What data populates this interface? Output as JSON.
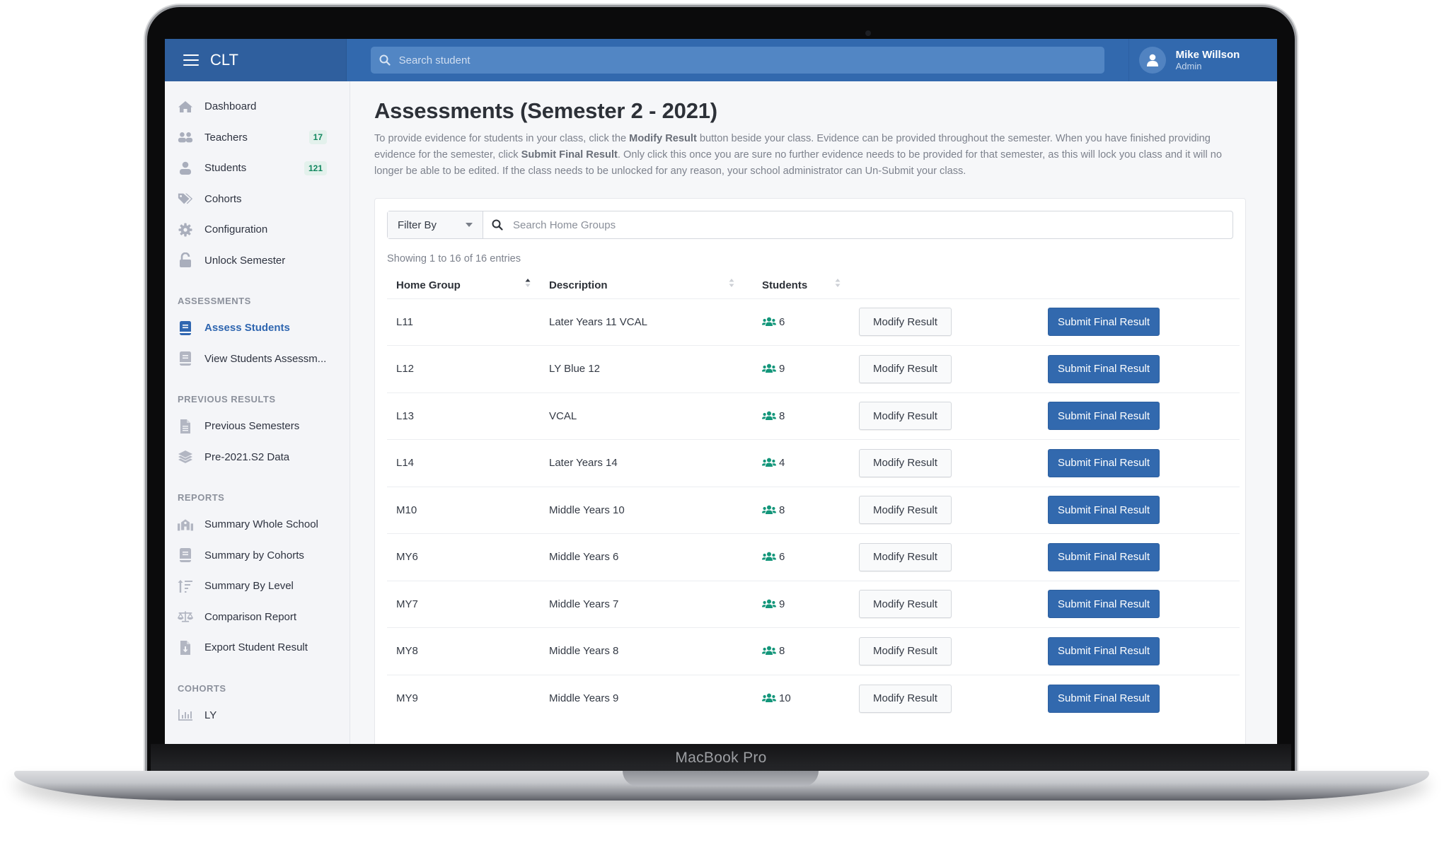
{
  "device": {
    "label": "MacBook Pro"
  },
  "topbar": {
    "app_name": "CLT",
    "search_placeholder": "Search student",
    "user": {
      "name": "Mike Willson",
      "role": "Admin"
    }
  },
  "sidebar": {
    "main_items": [
      {
        "label": "Dashboard",
        "icon": "home-icon"
      },
      {
        "label": "Teachers",
        "icon": "users-icon",
        "badge": "17"
      },
      {
        "label": "Students",
        "icon": "user-icon",
        "badge": "121"
      },
      {
        "label": "Cohorts",
        "icon": "tags-icon"
      },
      {
        "label": "Configuration",
        "icon": "gear-icon"
      },
      {
        "label": "Unlock Semester",
        "icon": "unlock-icon"
      }
    ],
    "sections": [
      {
        "title": "ASSESSMENTS",
        "items": [
          {
            "label": "Assess Students",
            "icon": "book-icon",
            "active": true
          },
          {
            "label": "View Students Assessm...",
            "icon": "book-icon"
          }
        ]
      },
      {
        "title": "PREVIOUS RESULTS",
        "items": [
          {
            "label": "Previous Semesters",
            "icon": "file-icon"
          },
          {
            "label": "Pre-2021.S2 Data",
            "icon": "layers-icon"
          }
        ]
      },
      {
        "title": "REPORTS",
        "items": [
          {
            "label": "Summary Whole School",
            "icon": "school-icon"
          },
          {
            "label": "Summary by Cohorts",
            "icon": "book-icon"
          },
          {
            "label": "Summary By Level",
            "icon": "sort-amount-icon"
          },
          {
            "label": "Comparison Report",
            "icon": "balance-scale-icon"
          },
          {
            "label": "Export Student Result",
            "icon": "file-download-icon"
          }
        ]
      },
      {
        "title": "COHORTS",
        "items": [
          {
            "label": "LY",
            "icon": "bar-chart-icon"
          }
        ]
      }
    ]
  },
  "main": {
    "title": "Assessments (Semester 2 - 2021)",
    "description": {
      "p1": "To provide evidence for students in your class, click the ",
      "b1": "Modify Result",
      "p2": " button beside your class. Evidence can be provided throughout the semester. When you have finished providing evidence for the semester, click ",
      "b2": "Submit Final Result",
      "p3": ". Only click this once you are sure no further evidence needs to be provided for that semester, as this will lock you class and it will no longer be able to be edited. If the class needs to be unlocked for any reason, your school administrator can Un-Submit your class."
    },
    "filter": {
      "label": "Filter By",
      "search_placeholder": "Search Home Groups"
    },
    "showing": "Showing 1 to 16 of 16 entries",
    "table": {
      "headers": {
        "home_group": "Home Group",
        "description": "Description",
        "students": "Students"
      },
      "modify_label": "Modify Result",
      "submit_label": "Submit Final Result",
      "rows": [
        {
          "home_group": "L11",
          "description": "Later Years 11 VCAL",
          "students": "6"
        },
        {
          "home_group": "L12",
          "description": "LY Blue 12",
          "students": "9"
        },
        {
          "home_group": "L13",
          "description": "VCAL",
          "students": "8"
        },
        {
          "home_group": "L14",
          "description": "Later Years 14",
          "students": "4"
        },
        {
          "home_group": "M10",
          "description": "Middle Years 10",
          "students": "8"
        },
        {
          "home_group": "MY6",
          "description": "Middle Years 6",
          "students": "6"
        },
        {
          "home_group": "MY7",
          "description": "Middle Years 7",
          "students": "9"
        },
        {
          "home_group": "MY8",
          "description": "Middle Years 8",
          "students": "8"
        },
        {
          "home_group": "MY9",
          "description": "Middle Years 9",
          "students": "10"
        }
      ]
    }
  },
  "colors": {
    "primary": "#3269ae",
    "brand_dark": "#2f5f9e",
    "badge_text": "#12875f",
    "students_icon": "#13967a"
  }
}
